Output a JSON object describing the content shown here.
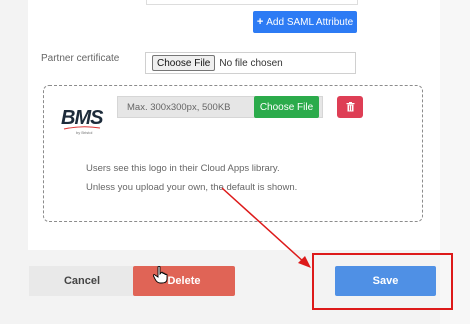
{
  "toolbar": {
    "add_saml_label": "Add SAML Attribute",
    "add_icon": "plus-icon"
  },
  "partner_certificate": {
    "label": "Partner certificate",
    "choose_file_label": "Choose File",
    "no_file_text": "No file chosen"
  },
  "logo_upload": {
    "logo_text": "BMS",
    "logo_subtext": "by Bristol",
    "max_text": "Max. 300x300px, 500KB",
    "choose_file_label": "Choose File",
    "delete_icon": "trash-icon",
    "info_line_1": "Users see this logo in their Cloud Apps library.",
    "info_line_2": "Unless you upload your own, the default is shown."
  },
  "footer": {
    "cancel_label": "Cancel",
    "delete_label": "Delete",
    "save_label": "Save"
  },
  "colors": {
    "accent_blue": "#2d7bf4",
    "success_green": "#2bab4b",
    "danger_red": "#de3e55",
    "delete_red": "#e06456",
    "save_blue": "#4f90e5",
    "annotation_red": "#dd1a1a"
  }
}
